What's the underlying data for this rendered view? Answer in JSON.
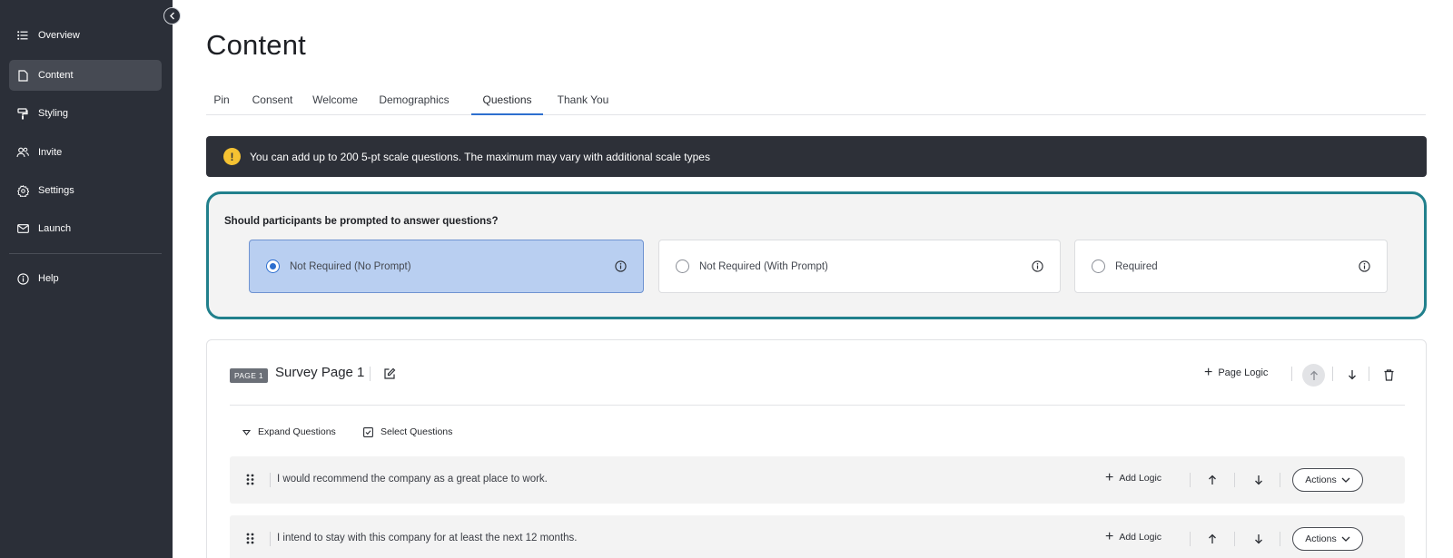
{
  "sidebar": {
    "items": [
      {
        "label": "Overview",
        "icon": "list-icon"
      },
      {
        "label": "Content",
        "icon": "document-icon",
        "active": true
      },
      {
        "label": "Styling",
        "icon": "paint-roller-icon"
      },
      {
        "label": "Invite",
        "icon": "users-icon"
      },
      {
        "label": "Settings",
        "icon": "gear-icon"
      },
      {
        "label": "Launch",
        "icon": "mail-icon"
      },
      {
        "label": "Help",
        "icon": "info-circle-icon"
      }
    ]
  },
  "page": {
    "title": "Content"
  },
  "tabs": [
    {
      "label": "Pin"
    },
    {
      "label": "Consent"
    },
    {
      "label": "Welcome"
    },
    {
      "label": "Demographics"
    },
    {
      "label": "Questions",
      "active": true
    },
    {
      "label": "Thank You"
    }
  ],
  "banner": {
    "icon_text": "!",
    "message": "You can add up to 200 5-pt scale questions. The maximum may vary with additional scale types"
  },
  "prompt": {
    "question": "Should participants be prompted to answer questions?",
    "options": [
      {
        "label": "Not Required (No Prompt)",
        "selected": true
      },
      {
        "label": "Not Required (With Prompt)",
        "selected": false
      },
      {
        "label": "Required",
        "selected": false
      }
    ]
  },
  "survey_page": {
    "badge": "PAGE 1",
    "name": "Survey Page 1",
    "page_logic_label": "Page Logic",
    "expand_label": "Expand Questions",
    "select_label": "Select Questions",
    "add_logic_label": "Add Logic",
    "actions_label": "Actions",
    "questions": [
      {
        "text": "I would recommend the company as a great place to work."
      },
      {
        "text": "I intend to stay with this company for at least the next 12 months."
      }
    ]
  },
  "colors": {
    "sidebar_bg": "#2b2f38",
    "accent_blue": "#2d6fcf",
    "selected_option_bg": "#b9cff1",
    "prompt_border": "#21808c",
    "warning_yellow": "#f5c232"
  }
}
